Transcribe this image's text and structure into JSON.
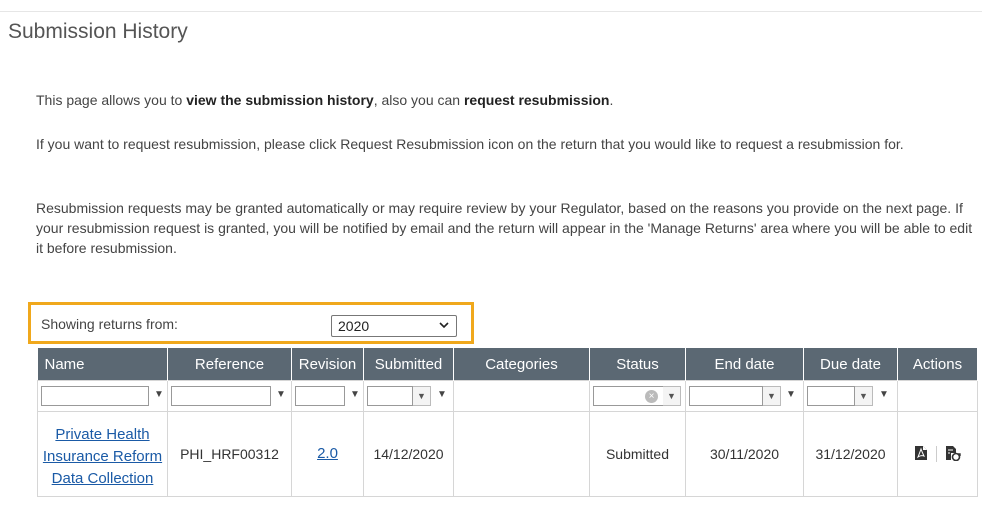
{
  "page": {
    "title": "Submission History"
  },
  "intro": {
    "p1_pre": "This page allows you to ",
    "p1_b1": "view the submission history",
    "p1_mid": ", also you can ",
    "p1_b2": "request resubmission",
    "p1_end": ".",
    "p2": "If you want to request resubmission, please click Request Resubmission icon on the return that you would like to request a resubmission for.",
    "p3": "Resubmission requests may be granted automatically or may require review by your Regulator, based on the reasons you provide on the next page. If your resubmission request is granted, you will be notified by email and the return will appear in the 'Manage Returns' area where you will be able to edit it before resubmission."
  },
  "filter": {
    "label": "Showing returns from:",
    "year": "2020"
  },
  "table": {
    "columns": [
      "Name",
      "Reference",
      "Revision",
      "Submitted",
      "Categories",
      "Status",
      "End date",
      "Due date",
      "Actions"
    ],
    "rows": [
      {
        "name": "Private Health Insurance Reform Data Collection",
        "reference": "PHI_HRF00312",
        "revision": "2.0",
        "submitted": "14/12/2020",
        "categories": "",
        "status": "Submitted",
        "end_date": "30/11/2020",
        "due_date": "31/12/2020"
      }
    ]
  },
  "icons": {
    "funnel": "filter-icon",
    "pdf": "pdf-icon",
    "resubmit": "request-resubmission-icon",
    "dropdown": "chevron-down-icon",
    "clear": "clear-icon"
  }
}
